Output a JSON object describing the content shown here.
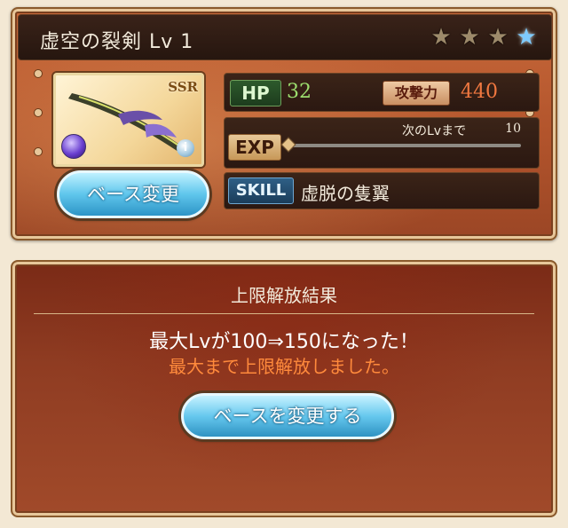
{
  "weapon": {
    "title": "虚空の裂剣 Lv 1",
    "rarity": "SSR",
    "stars": [
      "star-icon",
      "star-icon",
      "star-icon",
      "star-blue-icon"
    ],
    "info_glyph": "i"
  },
  "stats": {
    "hp_label": "HP",
    "hp_value": "32",
    "atk_label": "攻撃力",
    "atk_value": "440",
    "exp_label": "EXP",
    "next_lv_label": "次のLvまで",
    "next_lv_value": "10",
    "exp_progress": 0,
    "skill_label": "SKILL",
    "skill_name": "虚脱の隻翼"
  },
  "buttons": {
    "base_change": "ベース変更",
    "change_base": "ベースを変更する"
  },
  "result": {
    "title": "上限解放結果",
    "line1": "最大Lvが100⇒150になった！",
    "line2": "最大まで上限解放しました。"
  },
  "colors": {
    "hp_value": "#9cde6e",
    "atk_value": "#f07840",
    "highlight_text": "#ff8a3c",
    "button_blue": "#5fc6ec"
  }
}
